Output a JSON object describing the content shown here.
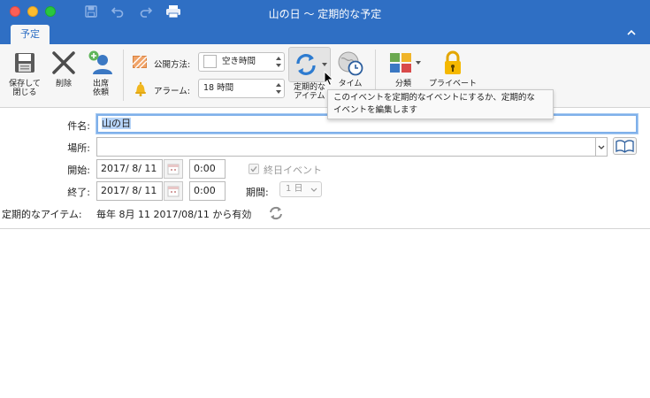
{
  "window": {
    "title": "山の日 〜 定期的な予定"
  },
  "tabs": [
    {
      "label": "予定"
    }
  ],
  "ribbon": {
    "save_close": "保存して\n閉じる",
    "delete": "削除",
    "invite": "出席\n依頼",
    "show_as_label": "公開方法:",
    "show_as_value": "空き時間",
    "alarm_label": "アラーム:",
    "alarm_value": "18 時間",
    "recurrence": "定期的な\nアイテム",
    "timezone": "タイム",
    "categorize": "分類",
    "private": "プライベート"
  },
  "tooltip": {
    "text": "このイベントを定期的なイベントにするか、定期的な\nイベントを編集します"
  },
  "form": {
    "subject_label": "件名:",
    "subject_value": "山の日",
    "location_label": "場所:",
    "location_value": "",
    "start_label": "開始:",
    "start_date": "2017/ 8/ 11",
    "start_time": "0:00",
    "end_label": "終了:",
    "end_date": "2017/ 8/ 11",
    "end_time": "0:00",
    "all_day_label": "終日イベント",
    "duration_label": "期間:",
    "duration_value": "1 日",
    "recurrence_label": "定期的なアイテム:",
    "recurrence_value": "毎年 8月 11 2017/08/11 から有効"
  },
  "colors": {
    "titlebar": "#2f6fc4",
    "ribbon_bg": "#f6f6f6",
    "accent": "#2f6fc4",
    "selection": "#b5d3f7"
  }
}
